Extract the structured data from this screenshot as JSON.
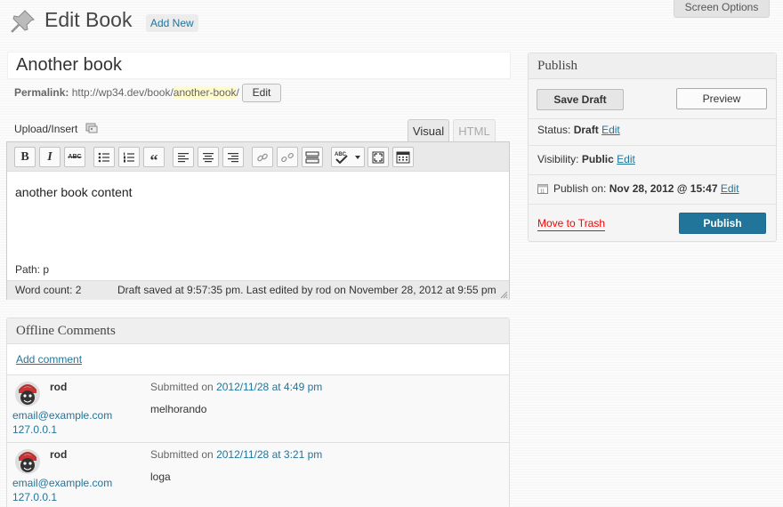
{
  "header": {
    "screen_options": "Screen Options",
    "title": "Edit Book",
    "add_new": "Add New",
    "page_icon": "pushpin-icon"
  },
  "post": {
    "title": "Another book",
    "permalink_label": "Permalink:",
    "permalink_base": "http://wp34.dev/book/",
    "permalink_slug": "another-book",
    "permalink_trail": "/",
    "permalink_edit": "Edit"
  },
  "editor": {
    "upload_insert": "Upload/Insert",
    "tab_visual": "Visual",
    "tab_html": "HTML",
    "toolbar_icons": [
      "bold-icon",
      "italic-icon",
      "strikethrough-icon",
      "bullet-list-icon",
      "numbered-list-icon",
      "blockquote-icon",
      "align-left-icon",
      "align-center-icon",
      "align-right-icon",
      "link-icon",
      "unlink-icon",
      "more-tag-icon",
      "spellcheck-icon",
      "fullscreen-icon",
      "kitchen-sink-icon"
    ],
    "content": "another book content",
    "path_label": "Path:",
    "path_value": "p",
    "word_count": "Word count: 2",
    "draft_saved": "Draft saved at 9:57:35 pm. Last edited by rod on November 28, 2012 at 9:55 pm"
  },
  "comments": {
    "title": "Offline Comments",
    "add_comment": "Add comment",
    "items": [
      {
        "author": "rod",
        "email": "email@example.com",
        "ip": "127.0.0.1",
        "submitted_prefix": "Submitted on",
        "submitted_date": "2012/11/28 at 4:49 pm",
        "text": "melhorando"
      },
      {
        "author": "rod",
        "email": "email@example.com",
        "ip": "127.0.0.1",
        "submitted_prefix": "Submitted on",
        "submitted_date": "2012/11/28 at 3:21 pm",
        "text": "loga"
      }
    ]
  },
  "publish": {
    "title": "Publish",
    "save_draft": "Save Draft",
    "preview": "Preview",
    "status_label": "Status:",
    "status_value": "Draft",
    "status_edit": "Edit",
    "visibility_label": "Visibility:",
    "visibility_value": "Public",
    "visibility_edit": "Edit",
    "publish_on_label": "Publish on:",
    "publish_on_value": "Nov 28, 2012 @ 15:47",
    "publish_on_edit": "Edit",
    "move_to_trash": "Move to Trash",
    "publish_button": "Publish"
  },
  "colors": {
    "link": "#21759b",
    "publish_button": "#21759b",
    "trash": "#ff0000"
  }
}
